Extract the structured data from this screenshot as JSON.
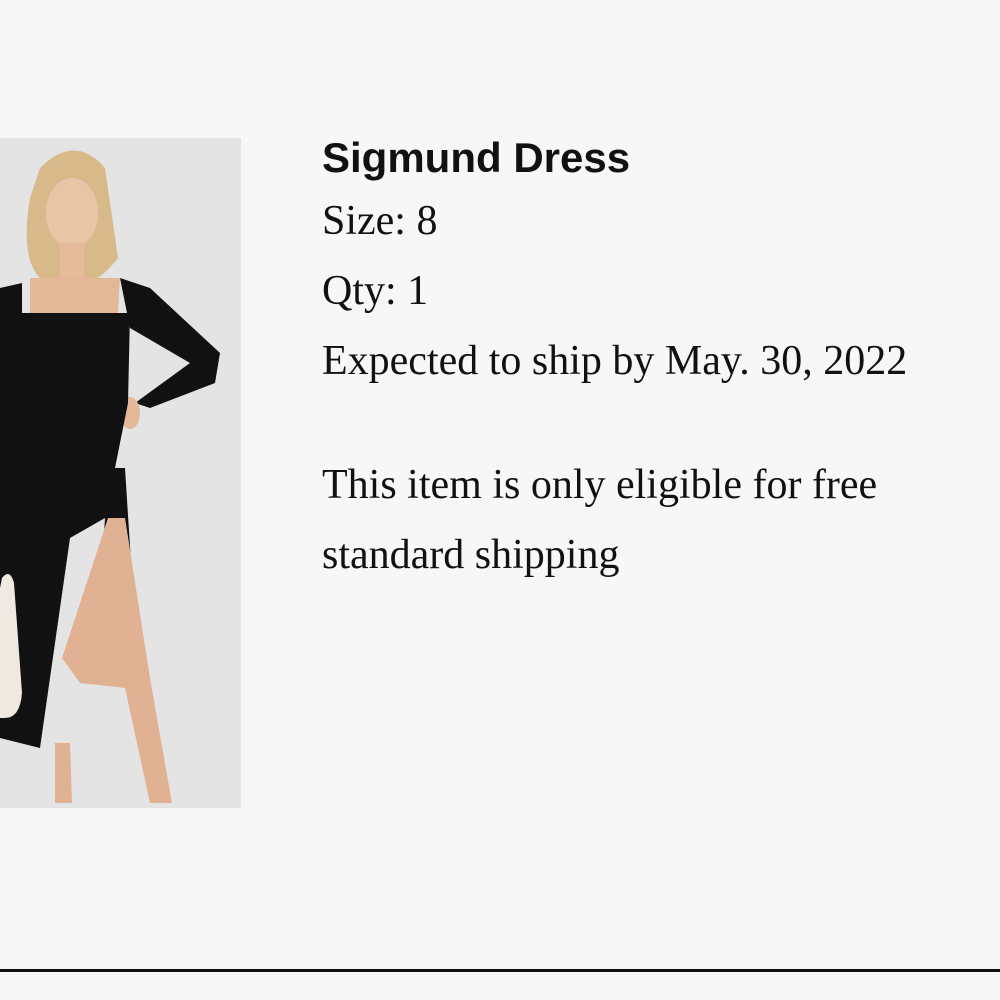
{
  "product": {
    "name": "Sigmund Dress",
    "size": "Size: 8",
    "qty": "Qty: 1",
    "ship_estimate": "Expected to ship by May. 30, 2022",
    "shipping_note": "This item is only eligible for free standard shipping"
  },
  "colors": {
    "background": "#f7f7f7",
    "text": "#111111",
    "image_backdrop": "#e3e3e3"
  }
}
